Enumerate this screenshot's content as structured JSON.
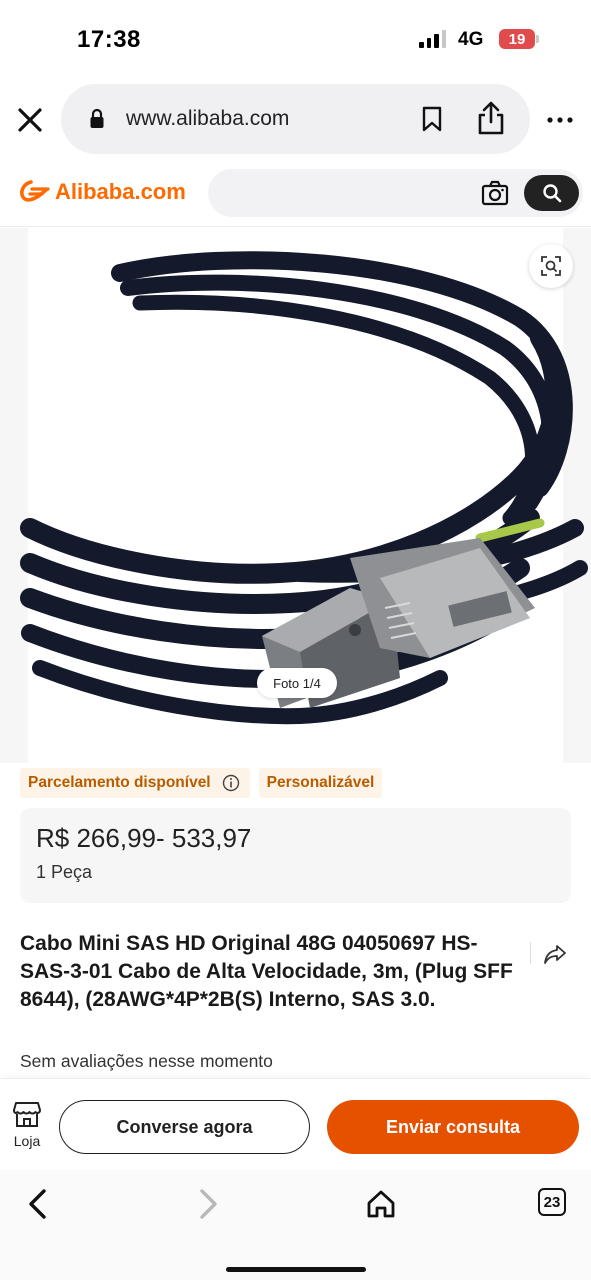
{
  "status_bar": {
    "time": "17:38",
    "network": "4G",
    "battery": "19",
    "battery_color": "#e04b4b"
  },
  "browser": {
    "url": "www.alibaba.com",
    "icons": [
      "close-icon",
      "lock-icon",
      "bookmark-icon",
      "share-icon",
      "more-icon"
    ]
  },
  "header": {
    "logo_text": "Alibaba.com",
    "brand_color": "#ff6a00",
    "icons": [
      "camera-icon",
      "search-icon"
    ]
  },
  "gallery": {
    "counter": "Foto 1/4",
    "icons": [
      "zoom-icon"
    ]
  },
  "tags": {
    "installments": "Parcelamento disponível",
    "customizable": "Personalizável",
    "tag_text_color": "#b85c00"
  },
  "price": {
    "range": "R$ 266,99- 533,97",
    "moq": "1 Peça"
  },
  "product": {
    "title": "Cabo Mini SAS HD Original 48G 04050697 HS-SAS-3-01 Cabo de Alta Velocidade, 3m, (Plug SFF 8644), (28AWG*4P*2B(S) Interno, SAS 3.0.",
    "reviews": "Sem avaliações nesse momento"
  },
  "actions": {
    "store_label": "Loja",
    "chat_label": "Converse agora",
    "inquiry_label": "Enviar consulta",
    "inquiry_color": "#e65100"
  },
  "browser_nav": {
    "tab_count": "23",
    "icons": [
      "back-icon",
      "forward-icon",
      "home-icon",
      "tabs-icon"
    ]
  }
}
